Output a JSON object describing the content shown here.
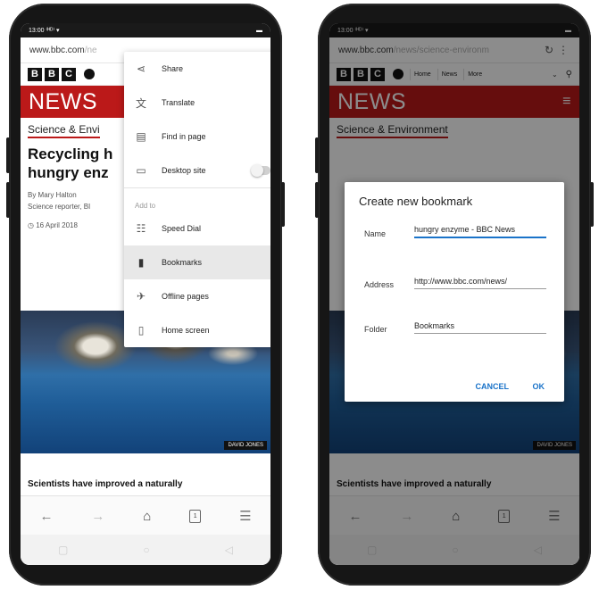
{
  "colors": {
    "bbc_red": "#bb1919",
    "accent_blue": "#1a73c9"
  },
  "left": {
    "status": {
      "time": "13:00 ⁽ᴴᴰ⁾ ▾",
      "battery": "▬"
    },
    "address": {
      "url": "www.bbc.com",
      "url_fade": "/ne"
    },
    "bbc_letters": [
      "B",
      "B",
      "C"
    ],
    "news_logo": "NEWS",
    "section": "Science & Envi",
    "headline_line1": "Recycling h",
    "headline_line2": "hungry enz",
    "byline_line1": "By Mary Halton",
    "byline_line2": "Science reporter, BI",
    "date": "16 April 2018",
    "photo_credit": "DAVID JONES",
    "teaser": "Scientists have improved a naturally",
    "menu": {
      "items_top": [
        {
          "label": "Share",
          "icon": "share-icon"
        },
        {
          "label": "Translate",
          "icon": "translate-icon"
        },
        {
          "label": "Find in page",
          "icon": "find-in-page-icon"
        },
        {
          "label": "Desktop site",
          "icon": "desktop-icon"
        }
      ],
      "section_label": "Add to",
      "items_bottom": [
        {
          "label": "Speed Dial",
          "icon": "speed-dial-icon"
        },
        {
          "label": "Bookmarks",
          "icon": "bookmark-icon",
          "selected": true
        },
        {
          "label": "Offline pages",
          "icon": "airplane-icon"
        },
        {
          "label": "Home screen",
          "icon": "phone-icon"
        }
      ]
    }
  },
  "right": {
    "status": {
      "time": "13:00 ⁽ᴴᴰ⁾ ▾",
      "battery": "▬"
    },
    "address": {
      "url": "www.bbc.com",
      "url_fade": "/news/science-environm"
    },
    "bbc_letters": [
      "B",
      "B",
      "C"
    ],
    "nav_links": [
      "Home",
      "News",
      "More"
    ],
    "news_logo": "NEWS",
    "section": "Science & Environment",
    "photo_credit": "DAVID JONES",
    "teaser": "Scientists have improved a naturally",
    "dialog": {
      "title": "Create new bookmark",
      "name_label": "Name",
      "name_value": "hungry enzyme - BBC News",
      "address_label": "Address",
      "address_value": "http://www.bbc.com/news/",
      "folder_label": "Folder",
      "folder_value": "Bookmarks",
      "cancel_label": "CANCEL",
      "ok_label": "OK"
    }
  }
}
